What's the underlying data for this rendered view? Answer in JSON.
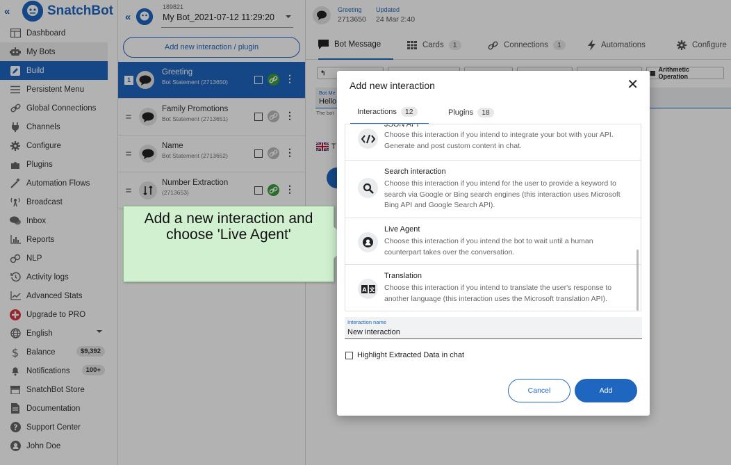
{
  "app": {
    "brand": "SnatchBot",
    "collapse_glyph": "«",
    "brand_color": "#1f66c1"
  },
  "sidebar": {
    "items": [
      {
        "label": "Dashboard",
        "icon": "dashboard-icon"
      },
      {
        "label": "My Bots",
        "icon": "robot-icon",
        "group": true
      },
      {
        "label": "Build",
        "icon": "pencil-icon",
        "active": true
      },
      {
        "label": "Persistent Menu",
        "icon": "menu-icon"
      },
      {
        "label": "Global Connections",
        "icon": "link-icon"
      },
      {
        "label": "Channels",
        "icon": "plug-icon"
      },
      {
        "label": "Configure",
        "icon": "gear-icon"
      },
      {
        "label": "Plugins",
        "icon": "puzzle-icon"
      },
      {
        "label": "Automation Flows",
        "icon": "wand-icon"
      },
      {
        "label": "Broadcast",
        "icon": "broadcast-icon"
      },
      {
        "label": "Inbox",
        "icon": "chat-icon"
      },
      {
        "label": "Reports",
        "icon": "reports-icon"
      },
      {
        "label": "NLP",
        "icon": "nlp-icon"
      },
      {
        "label": "Activity logs",
        "icon": "history-icon"
      },
      {
        "label": "Advanced Stats",
        "icon": "stats-icon"
      },
      {
        "label": "Upgrade to PRO",
        "icon": "upgrade-icon"
      },
      {
        "label": "English",
        "icon": "globe-icon"
      },
      {
        "label": "Balance",
        "icon": "dollar-icon",
        "badge": "$9,392"
      },
      {
        "label": "Notifications",
        "icon": "bell-icon",
        "badge": "100+"
      },
      {
        "label": "SnatchBot Store",
        "icon": "store-icon"
      },
      {
        "label": "Documentation",
        "icon": "document-icon"
      },
      {
        "label": "Support Center",
        "icon": "help-icon"
      },
      {
        "label": "John Doe",
        "icon": "user-icon"
      }
    ]
  },
  "bot": {
    "id": "189821",
    "name": "My Bot_2021-07-12 11:29:20",
    "collapse_glyph": "«"
  },
  "panel": {
    "add_button": "Add new interaction / plugin"
  },
  "interactions": [
    {
      "num": "1",
      "title": "Greeting",
      "subtitle": "Bot Statement (2713650)",
      "selected": true,
      "linked": true
    },
    {
      "title": "Family Promotions",
      "subtitle": "Bot Statement (2713651)",
      "linked": false
    },
    {
      "title": "Name",
      "subtitle": "Bot Statement (2713652)",
      "linked": false
    },
    {
      "title": "Number Extraction",
      "subtitle": "(2713653)",
      "linked": true
    }
  ],
  "header": {
    "label1": "Greeting",
    "value1": "2713650",
    "label2": "Updated",
    "value2": "24 Mar 2:40"
  },
  "tabs": [
    {
      "label": "Bot Message",
      "icon": "message-icon",
      "active": true
    },
    {
      "label": "Cards",
      "icon": "grid-icon",
      "count": "1"
    },
    {
      "label": "Connections",
      "icon": "link-icon",
      "count": "1"
    },
    {
      "label": "Automations",
      "icon": "bolt-icon"
    },
    {
      "label": "Configure",
      "icon": "gear-icon"
    }
  ],
  "toolbar": {
    "last": "Arithmetic Operation"
  },
  "message": {
    "label": "Bot Me",
    "value": "Hello",
    "sub": "The bot",
    "lang": "T"
  },
  "callout": {
    "line1": "Add a new interaction and",
    "line2": "choose 'Live Agent'"
  },
  "modal": {
    "title": "Add new interaction",
    "close": "✕",
    "tabs": [
      {
        "label": "Interactions",
        "count": "12",
        "active": true
      },
      {
        "label": "Plugins",
        "count": "18"
      }
    ],
    "items": [
      {
        "name": "JSON API",
        "icon": "code-icon",
        "desc": "Choose this interaction if you intend to integrate your bot with your API. Generate and post custom content in chat."
      },
      {
        "name": "Search interaction",
        "icon": "search-icon",
        "desc": "Choose this interaction if you intend for the user to provide a keyword to search via Google or Bing search engines (this interaction uses Microsoft Bing API and Google Search API)."
      },
      {
        "name": "Live Agent",
        "icon": "agent-icon",
        "desc": "Choose this interaction if you intend the bot to wait until a human counterpart takes over the conversation."
      },
      {
        "name": "Translation",
        "icon": "translate-icon",
        "desc": "Choose this interaction if you intend to translate the user's response to another language (this interaction uses the Microsoft translation API)."
      }
    ],
    "field": {
      "label": "Interaction name",
      "value": "New interaction"
    },
    "checkbox": "Highlight Extracted Data in chat",
    "cancel": "Cancel",
    "add": "Add"
  }
}
